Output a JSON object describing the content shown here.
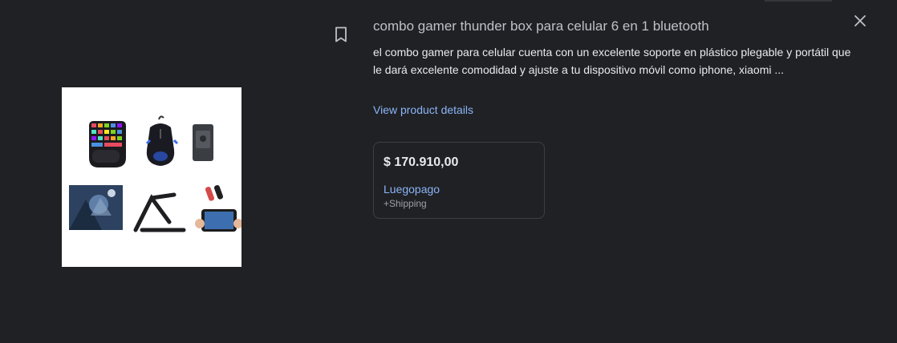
{
  "product": {
    "title": "combo gamer thunder box para celular 6 en 1 bluetooth",
    "description": "el combo gamer para celular cuenta con un excelente soporte en plástico plegable y portátil que le dará excelente comodidad y ajuste a tu dispositivo móvil como iphone, xiaomi ...",
    "details_link": "View product details"
  },
  "offer": {
    "price": "$ 170.910,00",
    "merchant": "Luegopago",
    "shipping": "+Shipping"
  },
  "icons": {
    "save": "bookmark-icon",
    "close": "close-icon"
  },
  "colors": {
    "background": "#202124",
    "link": "#8ab4f8",
    "text": "#e8eaed",
    "muted": "#bdc1c6"
  }
}
